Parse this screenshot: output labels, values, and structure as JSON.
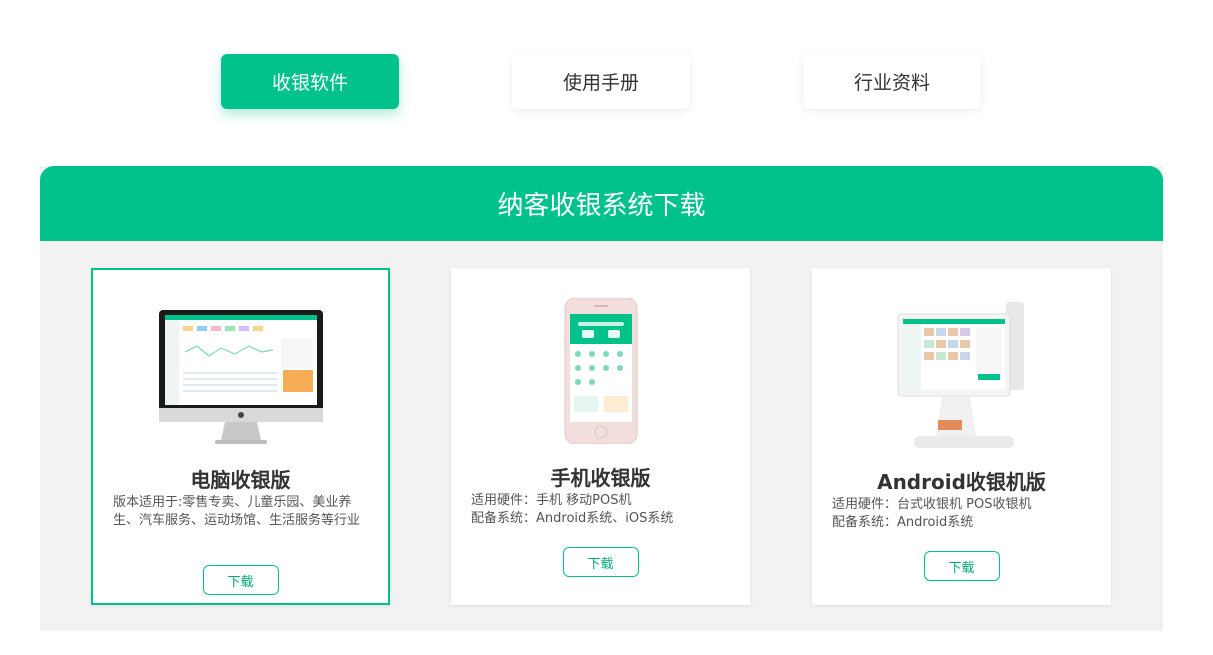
{
  "tabs": [
    {
      "label": "收银软件",
      "active": true
    },
    {
      "label": "使用手册",
      "active": false
    },
    {
      "label": "行业资料",
      "active": false
    }
  ],
  "panel": {
    "title": "纳客收银系统下载"
  },
  "cards": [
    {
      "title": "电脑收银版",
      "desc_lines": [
        "版本适用于:零售专卖、儿童乐园、美业养生、汽车服务、运动场馆、生活服务等行业"
      ],
      "button": "下载",
      "image": "desktop-monitor-image"
    },
    {
      "title": "手机收银版",
      "desc_lines": [
        "适用硬件：手机 移动POS机",
        "配备系统：Android系统、iOS系统"
      ],
      "button": "下载",
      "image": "smartphone-image"
    },
    {
      "title": "Android收银机版",
      "desc_lines": [
        "适用硬件：台式收银机 POS收银机",
        "配备系统：Android系统"
      ],
      "button": "下载",
      "image": "pos-terminal-image"
    }
  ],
  "colors": {
    "accent": "#00c28a",
    "panel_bg": "#f2f2f2"
  }
}
